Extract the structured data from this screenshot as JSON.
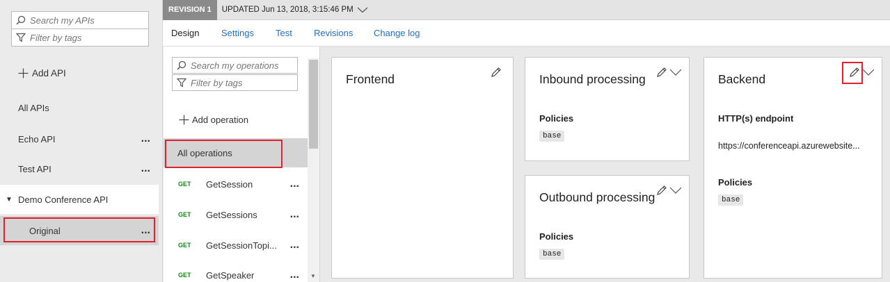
{
  "api_panel": {
    "search_placeholder": "Search my APIs",
    "filter_placeholder": "Filter by tags",
    "add_api_label": "Add API",
    "items": [
      {
        "label": "All APIs"
      },
      {
        "label": "Echo API",
        "menu": "..."
      },
      {
        "label": "Test API",
        "menu": "..."
      },
      {
        "label": "Demo Conference API",
        "expanded": true
      },
      {
        "label": "Original",
        "menu": "...",
        "selected": true
      }
    ]
  },
  "revision": {
    "badge": "REVISION 1",
    "updated": "UPDATED Jun 13, 2018, 3:15:46 PM"
  },
  "tabs": [
    "Design",
    "Settings",
    "Test",
    "Revisions",
    "Change log"
  ],
  "active_tab": "Design",
  "operations": {
    "search_placeholder": "Search my operations",
    "filter_placeholder": "Filter by tags",
    "add_operation_label": "Add operation",
    "all_label": "All operations",
    "items": [
      {
        "method": "GET",
        "name": "GetSession",
        "menu": "..."
      },
      {
        "method": "GET",
        "name": "GetSessions",
        "menu": "..."
      },
      {
        "method": "GET",
        "name": "GetSessionTopi...",
        "menu": "..."
      },
      {
        "method": "GET",
        "name": "GetSpeaker",
        "menu": "..."
      }
    ]
  },
  "design": {
    "frontend": {
      "title": "Frontend"
    },
    "inbound": {
      "title": "Inbound processing",
      "policies_label": "Policies",
      "policy": "base"
    },
    "outbound": {
      "title": "Outbound processing",
      "policies_label": "Policies",
      "policy": "base"
    },
    "backend": {
      "title": "Backend",
      "endpoint_label": "HTTP(s) endpoint",
      "endpoint": "https://conferenceapi.azurewebsite...",
      "policies_label": "Policies",
      "policy": "base"
    }
  },
  "colors": {
    "accent_link": "#1f6fc7",
    "highlight": "#e0202b",
    "get_method": "#128a12",
    "selected_bg": "#d4d4d4"
  },
  "icons": [
    "search-icon",
    "filter-icon",
    "plus-icon",
    "pencil-icon",
    "chevron-down-icon",
    "caret-down-icon"
  ]
}
